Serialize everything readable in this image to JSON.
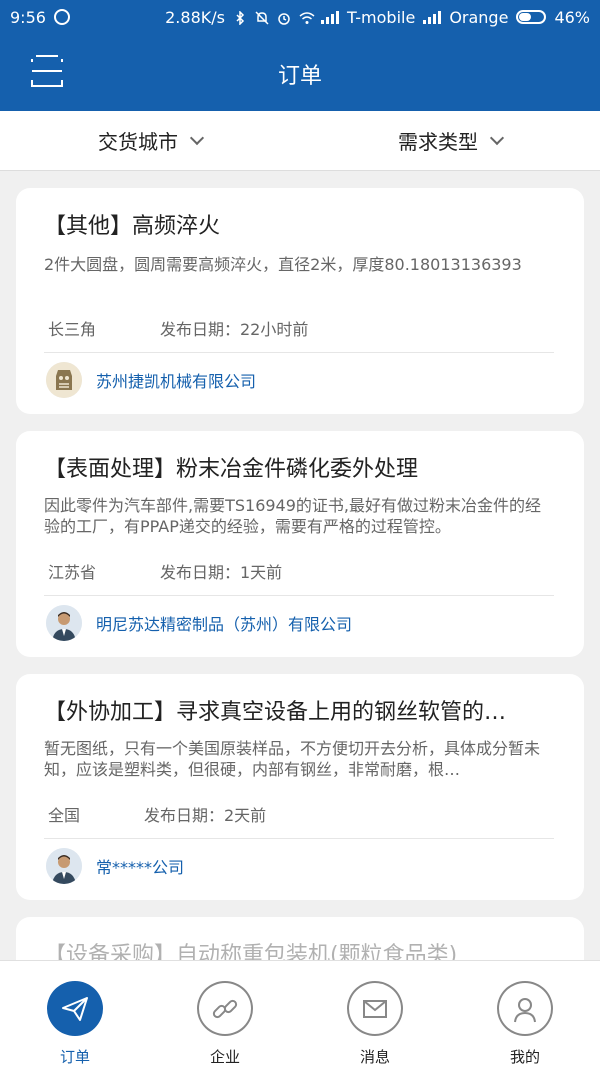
{
  "status_bar": {
    "time": "9:56",
    "speed": "2.88K/s",
    "carrier1": "T-mobile",
    "carrier2": "Orange",
    "battery": "46%"
  },
  "header": {
    "title": "订单"
  },
  "filters": {
    "city_label": "交货城市",
    "type_label": "需求类型"
  },
  "orders": [
    {
      "title": "【其他】高频淬火",
      "description": "2件大圆盘，圆周需要高频淬火，直径2米，厚度80.18013136393",
      "region": "长三角",
      "date": "发布日期：22小时前",
      "company": "苏州捷凯机械有限公司"
    },
    {
      "title": "【表面处理】粉末冶金件磷化委外处理",
      "description": "因此零件为汽车部件,需要TS16949的证书,最好有做过粉末冶金件的经验的工厂，有PPAP递交的经验，需要有严格的过程管控。",
      "region": "江苏省",
      "date": "发布日期：1天前",
      "company": "明尼苏达精密制品（苏州）有限公司"
    },
    {
      "title": "【外协加工】寻求真空设备上用的钢丝软管的…",
      "description": "暂无图纸，只有一个美国原装样品，不方便切开去分析，具体成分暂未知，应该是塑料类，但很硬，内部有钢丝，非常耐磨，根…",
      "region": "全国",
      "date": "发布日期：2天前",
      "company": "常*****公司"
    },
    {
      "title": "【设备采购】自动称重包装机(颗粒食品类)"
    }
  ],
  "tabs": [
    {
      "label": "订单",
      "icon": "paper-plane-icon",
      "active": true
    },
    {
      "label": "企业",
      "icon": "link-icon",
      "active": false
    },
    {
      "label": "消息",
      "icon": "envelope-icon",
      "active": false
    },
    {
      "label": "我的",
      "icon": "user-icon",
      "active": false
    }
  ],
  "colors": {
    "primary": "#1560ad",
    "background": "#f0f0f0"
  }
}
